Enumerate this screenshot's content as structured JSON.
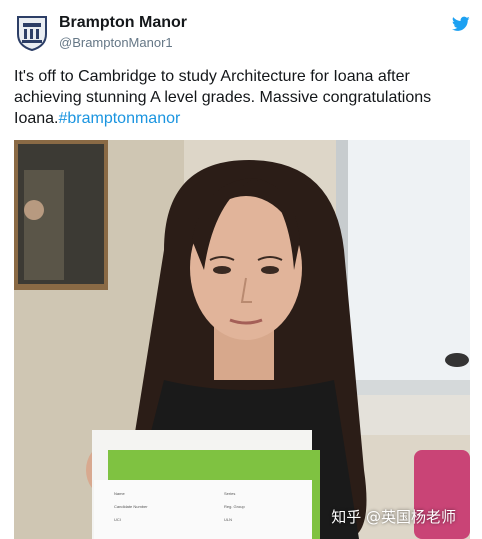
{
  "tweet": {
    "author_name": "Brampton Manor",
    "author_handle": "@BramptonManor1",
    "text_line1": "It's off to Cambridge to study Architecture for Ioana after",
    "text_line2": "achieving stunning A level grades. Massive congratulations",
    "text_line3_prefix": "Ioana.",
    "hashtag": "#bramptonmanor",
    "avatar_icon": "school-crest-icon",
    "brand_icon": "twitter-bird-icon",
    "brand_color": "#1da1f2",
    "hashtag_color": "#1b95e0"
  },
  "photo": {
    "description_icon": "student-holding-results-photo"
  },
  "watermark": {
    "text": "知乎 @英国杨老师"
  }
}
